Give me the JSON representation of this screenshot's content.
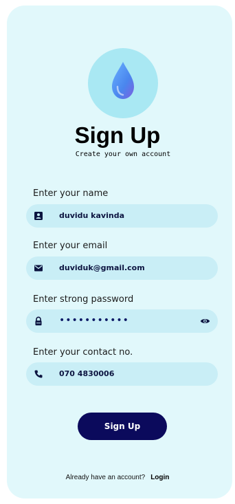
{
  "header": {
    "title": "Sign Up",
    "subtitle": "Create your own account"
  },
  "form": {
    "name": {
      "label": "Enter your name",
      "value": "duvidu kavinda",
      "icon": "contact-card-icon"
    },
    "email": {
      "label": "Enter your email",
      "value": "duviduk@gmail.com",
      "icon": "mail-icon"
    },
    "password": {
      "label": "Enter strong password",
      "value": "•••••••••••",
      "icon": "lock-icon",
      "toggle_icon": "eye-icon"
    },
    "contact": {
      "label": "Enter your contact no.",
      "value": "070 4830006",
      "icon": "phone-icon"
    }
  },
  "actions": {
    "signup_label": "Sign Up"
  },
  "footer": {
    "prompt": "Already have an account?",
    "login_label": "Login"
  },
  "colors": {
    "background": "#e1f8fb",
    "field": "#c9eef6",
    "button": "#0b0a5c",
    "logo_circle": "#a9e8f3",
    "drop": "#4a86ee"
  }
}
